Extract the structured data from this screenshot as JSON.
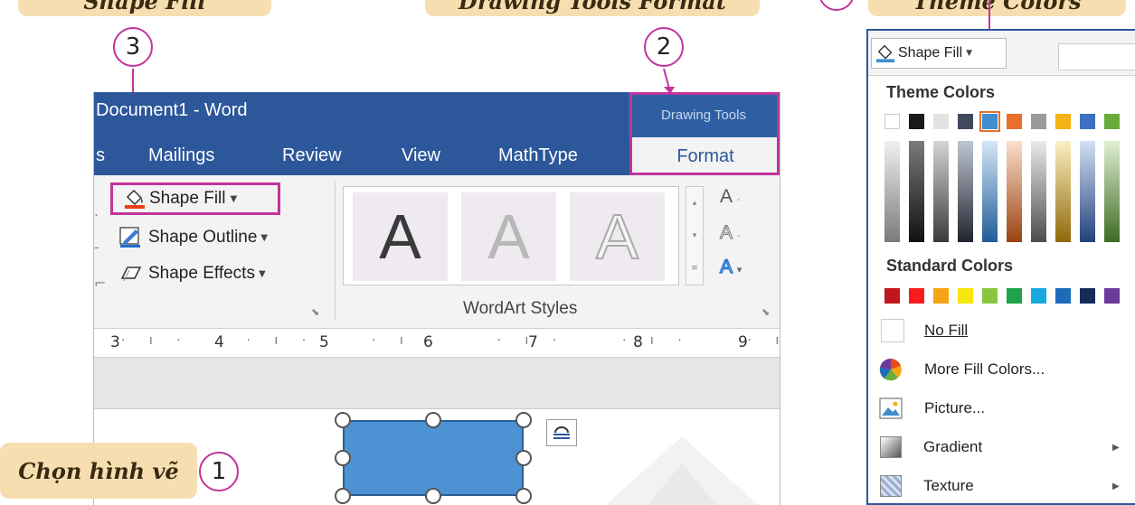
{
  "callouts": {
    "top_left": "Shape Fill",
    "top_mid": "Drawing Tools Format",
    "top_right": "Theme Colors",
    "select_shape": "Chọn hình vẽ"
  },
  "markers": {
    "one": "1",
    "two": "2",
    "three": "3"
  },
  "word": {
    "title": "Document1 - Word",
    "drawing_tools": "Drawing Tools",
    "tabs": [
      {
        "label": "s"
      },
      {
        "label": "Mailings"
      },
      {
        "label": "Review"
      },
      {
        "label": "View"
      },
      {
        "label": "MathType"
      }
    ],
    "format_tab": "Format",
    "shape_fill": "Shape Fill",
    "shape_outline": "Shape Outline",
    "shape_effects": "Shape Effects",
    "wordart_letter": "A",
    "wordart_group": "WordArt Styles",
    "ruler": [
      "3",
      "4",
      "5",
      "6",
      "7",
      "8",
      "9"
    ]
  },
  "dropdown": {
    "button": "Shape Fill",
    "theme_colors": "Theme Colors",
    "standard_colors": "Standard Colors",
    "no_fill": "No Fill",
    "more_fill_colors": "More Fill Colors...",
    "picture": "Picture...",
    "gradient": "Gradient",
    "texture": "Texture",
    "theme_top": [
      "#ffffff",
      "#1a1a1a",
      "#e2e2e2",
      "#3f4a5c",
      "#3f8fd0",
      "#e8702a",
      "#9a9a9a",
      "#f4b213",
      "#3f6fc2",
      "#6aab3c"
    ],
    "standard": [
      "#c0161c",
      "#fa1c1c",
      "#f6a415",
      "#f7e50e",
      "#8ac53f",
      "#1fa34a",
      "#17a8e0",
      "#1b6bb8",
      "#142c5c",
      "#6c3a9a"
    ]
  },
  "colors": {
    "accent": "#c2349b",
    "word_blue": "#2c579a",
    "shape_blue": "#4d92d2"
  }
}
